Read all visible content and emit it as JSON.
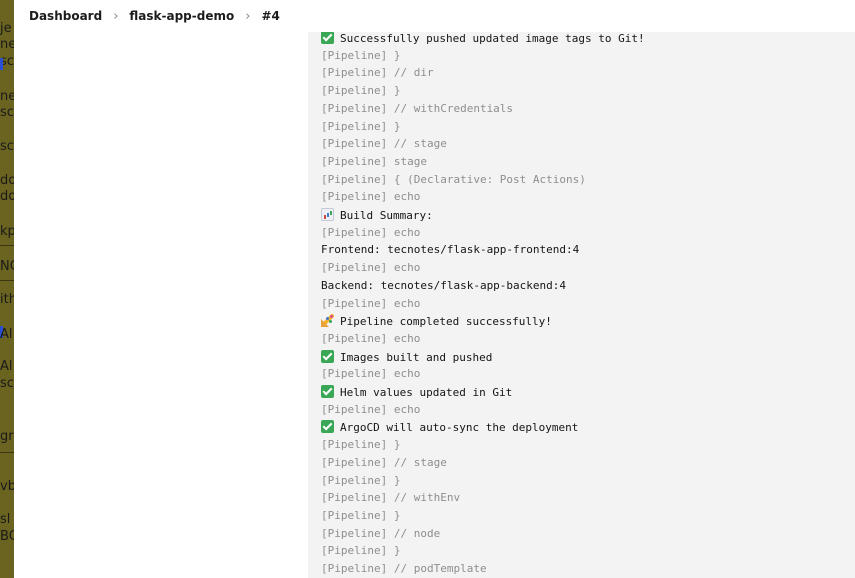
{
  "background_window": {
    "fragments": [
      "je",
      "ne",
      "sc",
      "ne",
      "sc",
      "sc",
      "do",
      "do",
      "kp",
      "NC",
      "ith",
      "Al",
      "Al",
      "sc",
      "gr",
      "vb",
      "sl",
      "BC"
    ]
  },
  "breadcrumb": {
    "items": [
      "Dashboard",
      "flask-app-demo",
      "#4"
    ]
  },
  "console": {
    "lines": [
      {
        "kind": "output",
        "icon": "check-mark-icon",
        "text": "Successfully pushed updated image tags to Git!"
      },
      {
        "kind": "pipeline",
        "text": "[Pipeline] }"
      },
      {
        "kind": "pipeline",
        "text": "[Pipeline] // dir"
      },
      {
        "kind": "pipeline",
        "text": "[Pipeline] }"
      },
      {
        "kind": "pipeline",
        "text": "[Pipeline] // withCredentials"
      },
      {
        "kind": "pipeline",
        "text": "[Pipeline] }"
      },
      {
        "kind": "pipeline",
        "text": "[Pipeline] // stage"
      },
      {
        "kind": "pipeline",
        "text": "[Pipeline] stage"
      },
      {
        "kind": "pipeline",
        "text": "[Pipeline] { (Declarative: Post Actions)"
      },
      {
        "kind": "pipeline",
        "text": "[Pipeline] echo"
      },
      {
        "kind": "output",
        "icon": "bar-chart-icon",
        "text": "Build Summary:"
      },
      {
        "kind": "pipeline",
        "text": "[Pipeline] echo"
      },
      {
        "kind": "output",
        "text": "Frontend: tecnotes/flask-app-frontend:4"
      },
      {
        "kind": "pipeline",
        "text": "[Pipeline] echo"
      },
      {
        "kind": "output",
        "text": "Backend: tecnotes/flask-app-backend:4"
      },
      {
        "kind": "pipeline",
        "text": "[Pipeline] echo"
      },
      {
        "kind": "output",
        "icon": "party-popper-icon",
        "text": "Pipeline completed successfully!"
      },
      {
        "kind": "pipeline",
        "text": "[Pipeline] echo"
      },
      {
        "kind": "output",
        "icon": "check-mark-icon",
        "text": "Images built and pushed"
      },
      {
        "kind": "pipeline",
        "text": "[Pipeline] echo"
      },
      {
        "kind": "output",
        "icon": "check-mark-icon",
        "text": "Helm values updated in Git"
      },
      {
        "kind": "pipeline",
        "text": "[Pipeline] echo"
      },
      {
        "kind": "output",
        "icon": "check-mark-icon",
        "text": "ArgoCD will auto-sync the deployment"
      },
      {
        "kind": "pipeline",
        "text": "[Pipeline] }"
      },
      {
        "kind": "pipeline",
        "text": "[Pipeline] // stage"
      },
      {
        "kind": "pipeline",
        "text": "[Pipeline] }"
      },
      {
        "kind": "pipeline",
        "text": "[Pipeline] // withEnv"
      },
      {
        "kind": "pipeline",
        "text": "[Pipeline] }"
      },
      {
        "kind": "pipeline",
        "text": "[Pipeline] // node"
      },
      {
        "kind": "pipeline",
        "text": "[Pipeline] }"
      },
      {
        "kind": "pipeline",
        "text": "[Pipeline] // podTemplate"
      }
    ]
  }
}
